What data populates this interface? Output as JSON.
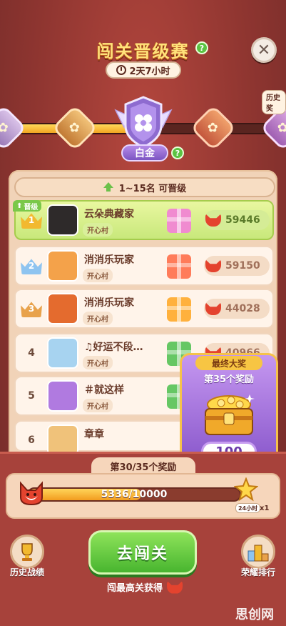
{
  "header": {
    "title": "闯关晋级赛",
    "help": "?",
    "close": "✕",
    "timer": "2天7小时"
  },
  "rank_track": {
    "current_rank": "白金",
    "rank_help": "?",
    "history_label": "历史奖"
  },
  "promotion": {
    "banner": "1~15名  可晋级",
    "tag": "晋级"
  },
  "leaderboard": [
    {
      "rank": "1",
      "name": "云朵典藏家",
      "village": "开心村",
      "score": "59446",
      "gift_color": "#f08bd0",
      "crown_color": "#f2b92f"
    },
    {
      "rank": "2",
      "name": "消消乐玩家",
      "village": "开心村",
      "score": "59150",
      "gift_color": "#ff7c5a",
      "crown_color": "#8ec4f0"
    },
    {
      "rank": "3",
      "name": "消消乐玩家",
      "village": "开心村",
      "score": "44028",
      "gift_color": "#ffb13d",
      "crown_color": "#e8a24b"
    },
    {
      "rank": "4",
      "name": "♫好运不段…",
      "village": "开心村",
      "score": "40966",
      "gift_color": "#66c764",
      "crown_color": ""
    },
    {
      "rank": "5",
      "name": "＃就这样",
      "village": "开心村",
      "score": "",
      "gift_color": "#66c764",
      "crown_color": ""
    },
    {
      "rank": "6",
      "name": "章章",
      "village": "",
      "score": "",
      "gift_color": "#66c764",
      "crown_color": ""
    }
  ],
  "final_reward": {
    "title": "最终大奖",
    "subtitle": "第35个奖励",
    "amount": "100"
  },
  "progress": {
    "title": "第30/35个奖励",
    "text": "5336/10000",
    "fraction": 0.5336,
    "time_tag": "24小时",
    "multiplier": "x1"
  },
  "footer": {
    "history_label": "历史战绩",
    "go_label": "去闯关",
    "honor_label": "荣耀排行",
    "hint": "闯最高关获得"
  },
  "watermark": "思创网",
  "colors": {
    "accent_green": "#48b52f",
    "background": "#8e3530",
    "rank_purple": "#7c55c2"
  }
}
